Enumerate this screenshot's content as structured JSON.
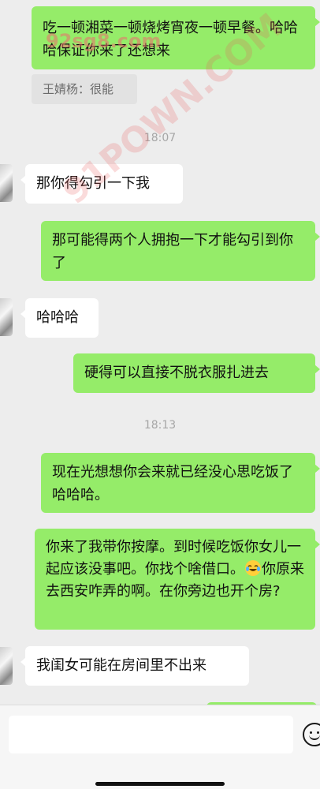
{
  "chat": {
    "messages": [
      {
        "text": "吃一顿湘菜一顿烧烤宵夜一顿早餐。哈哈哈保证你来了还想来"
      },
      {
        "quote": "王婧杨：很能"
      },
      {
        "time": "18:07"
      },
      {
        "text": "那你得勾引一下我"
      },
      {
        "text": "那可能得两个人拥抱一下才能勾引到你了"
      },
      {
        "text": "哈哈哈"
      },
      {
        "text": "硬得可以直接不脱衣服扎进去"
      },
      {
        "time": "18:13"
      },
      {
        "text": "现在光想想你会来就已经没心思吃饭了哈哈哈。"
      },
      {
        "text_before": "你来了我带你按摩。到时候吃饭你女儿一起应该没事吧。你找个啥借口。",
        "emoji": "😂",
        "text_after": "你原来去西安咋弄的啊。在你旁边也开个房?"
      },
      {
        "text": "我闺女可能在房间里不出来"
      }
    ]
  },
  "watermark": {
    "text1": "92sg8.com",
    "text2": "91POWN.COM"
  },
  "colors": {
    "background": "#ededed",
    "outgoing_bubble": "#95ec69",
    "incoming_bubble": "#ffffff"
  }
}
